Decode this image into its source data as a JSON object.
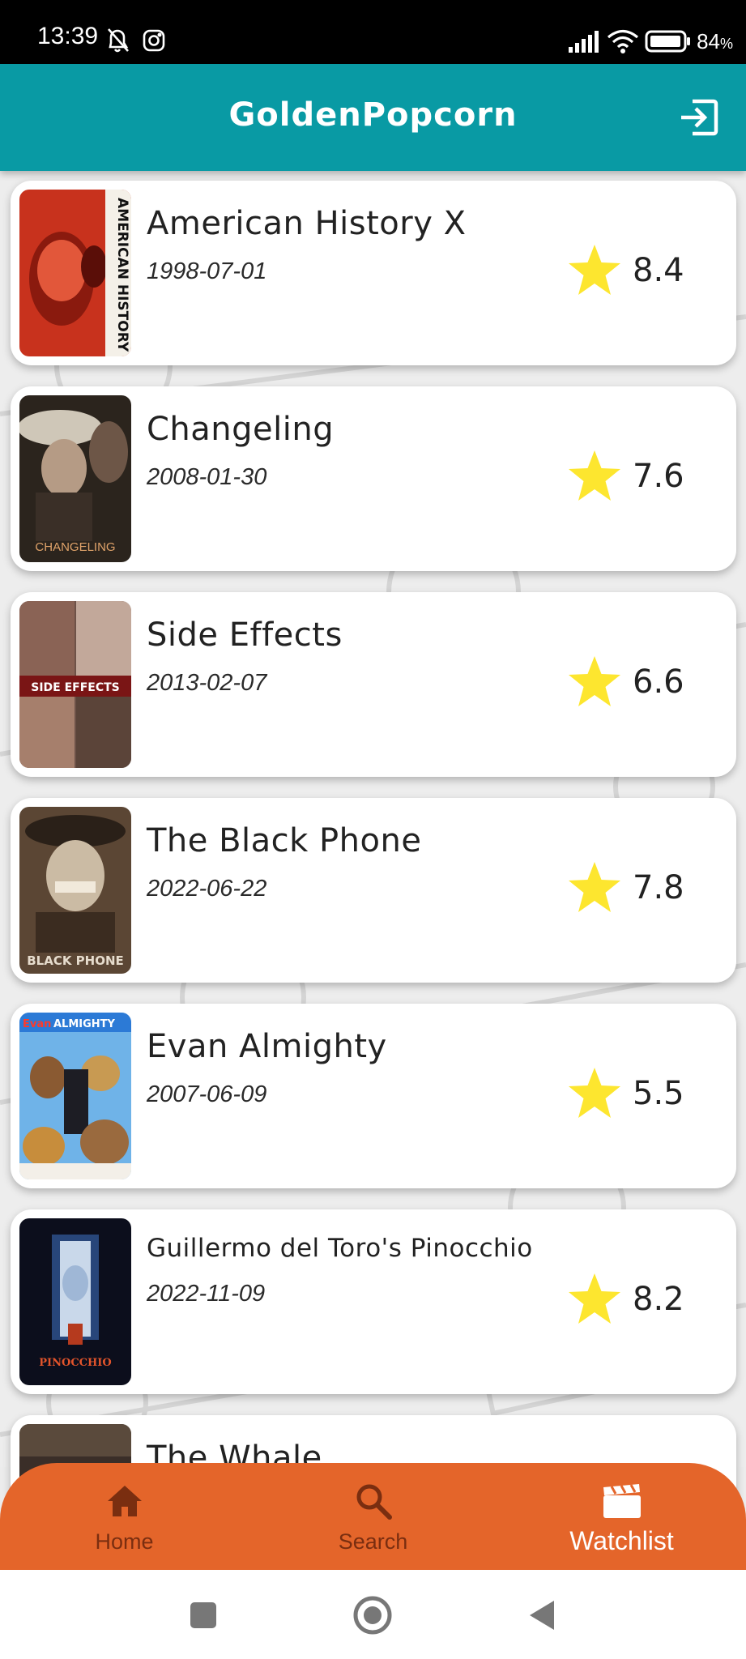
{
  "status_bar": {
    "time": "13:39",
    "battery": "84",
    "icons_left": [
      "mute-notifications-icon",
      "instagram-icon"
    ],
    "icons_right": [
      "signal-icon",
      "wifi-icon",
      "battery-icon"
    ]
  },
  "app_bar": {
    "title": "GoldenPopcorn",
    "logout_icon": "logout-icon"
  },
  "movies": [
    {
      "title": "American History X",
      "date": "1998-07-01",
      "rating": "8.4"
    },
    {
      "title": "Changeling",
      "date": "2008-01-30",
      "rating": "7.6"
    },
    {
      "title": "Side Effects",
      "date": "2013-02-07",
      "rating": "6.6"
    },
    {
      "title": "The Black Phone",
      "date": "2022-06-22",
      "rating": "7.8"
    },
    {
      "title": "Evan Almighty",
      "date": "2007-06-09",
      "rating": "5.5"
    },
    {
      "title": "Guillermo del Toro's Pinocchio",
      "date": "2022-11-09",
      "rating": "8.2"
    },
    {
      "title": "The Whale",
      "date": "",
      "rating": ""
    }
  ],
  "posters": {
    "p1": "AMERICAN HISTORY X",
    "p2": "CHANGELING",
    "p3": "SIDE EFFECTS",
    "p4": "BLACK PHONE",
    "p5a": "Evan",
    "p5b": "ALMIGHTY",
    "p6": "PINOCCHIO"
  },
  "bottom_nav": {
    "items": [
      {
        "label": "Home",
        "icon": "home-icon"
      },
      {
        "label": "Search",
        "icon": "search-icon"
      },
      {
        "label": "Watchlist",
        "icon": "clapperboard-icon"
      }
    ],
    "active": "Watchlist"
  },
  "colors": {
    "app_bar": "#099aa4",
    "bottom_nav": "#e4652a",
    "star": "#fde62f",
    "active_label": "#ffffff",
    "inactive_label": "#7a2e10"
  }
}
